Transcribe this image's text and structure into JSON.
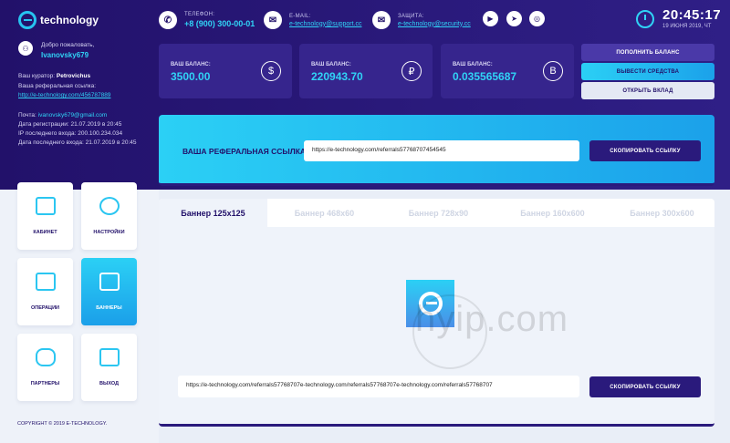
{
  "brand": {
    "logo_text": "technology"
  },
  "header": {
    "phone": {
      "label": "ТЕЛЕФОН:",
      "value": "+8 (900) 300-00-01"
    },
    "email": {
      "label": "E-MAIL:",
      "value": "e-technology@support.cc"
    },
    "security": {
      "label": "ЗАЩИТА:",
      "value": "e-technology@security.cc"
    },
    "social": [
      "youtube-icon",
      "telegram-icon",
      "instagram-icon"
    ],
    "time": "20:45:17",
    "date": "19 ИЮНЯ 2019, ЧТ"
  },
  "user": {
    "welcome": "Добро пожаловать,",
    "name": "Ivanovsky679",
    "curator_label": "Ваш куратор:",
    "curator_name": "Petrovichus",
    "ref_link_label": "Ваша реферальная ссылка:",
    "ref_link": "http://e-technology.com/456787889",
    "mail_label": "Почта:",
    "mail": "ivanovsky679@gmail.com",
    "reg_label": "Дата регистрации:",
    "reg_date": "21.07.2019 в 20:45",
    "ip_label": "IP последнего входа:",
    "ip": "200.100.234.034",
    "last_label": "Дата последнего входа:",
    "last_date": "21.07.2019 в 20:45"
  },
  "balances": [
    {
      "label": "ВАШ БАЛАНС:",
      "value": "3500.00",
      "symbol": "$"
    },
    {
      "label": "ВАШ БАЛАНС:",
      "value": "220943.70",
      "symbol": "₽"
    },
    {
      "label": "ВАШ БАЛАНС:",
      "value": "0.035565687",
      "symbol": "B"
    }
  ],
  "actions": {
    "deposit": "ПОПОЛНИТЬ БАЛАНС",
    "withdraw": "ВЫВЕСТИ СРЕДСТВА",
    "open": "ОТКРЫТЬ ВКЛАД"
  },
  "referral": {
    "label": "ВАША РЕФЕРАЛЬНАЯ ССЫЛКА:",
    "value": "https://e-technology.com/referrals57768707454545",
    "copy": "СКОПИРОВАТЬ ССЫЛКУ"
  },
  "nav": [
    {
      "label": "КАБИНЕТ",
      "icon": "user-frame-icon"
    },
    {
      "label": "НАСТРОЙКИ",
      "icon": "gear-icon"
    },
    {
      "label": "ОПЕРАЦИИ",
      "icon": "chart-icon"
    },
    {
      "label": "БАННЕРЫ",
      "icon": "folder-icon"
    },
    {
      "label": "ПАРТНЕРЫ",
      "icon": "partners-icon"
    },
    {
      "label": "ВЫХОД",
      "icon": "exit-icon"
    }
  ],
  "footer": {
    "copyright": "COPYRIGHT © 2019 E-TECHNOLOGY."
  },
  "banners": {
    "tabs": [
      "Баннер 125x125",
      "Баннер 468x60",
      "Баннер 728x90",
      "Баннер 160x600",
      "Баннер 300x600"
    ],
    "active_tab": 0,
    "watermark": "hyip.com",
    "code": "https://e-technology.com/referrals57768707e-technology.com/referrals57768707e-technology.com/referrals57768707",
    "copy": "СКОПИРОВАТЬ ССЫЛКУ"
  },
  "colors": {
    "primary": "#22116a",
    "accent": "#30d3f6"
  }
}
